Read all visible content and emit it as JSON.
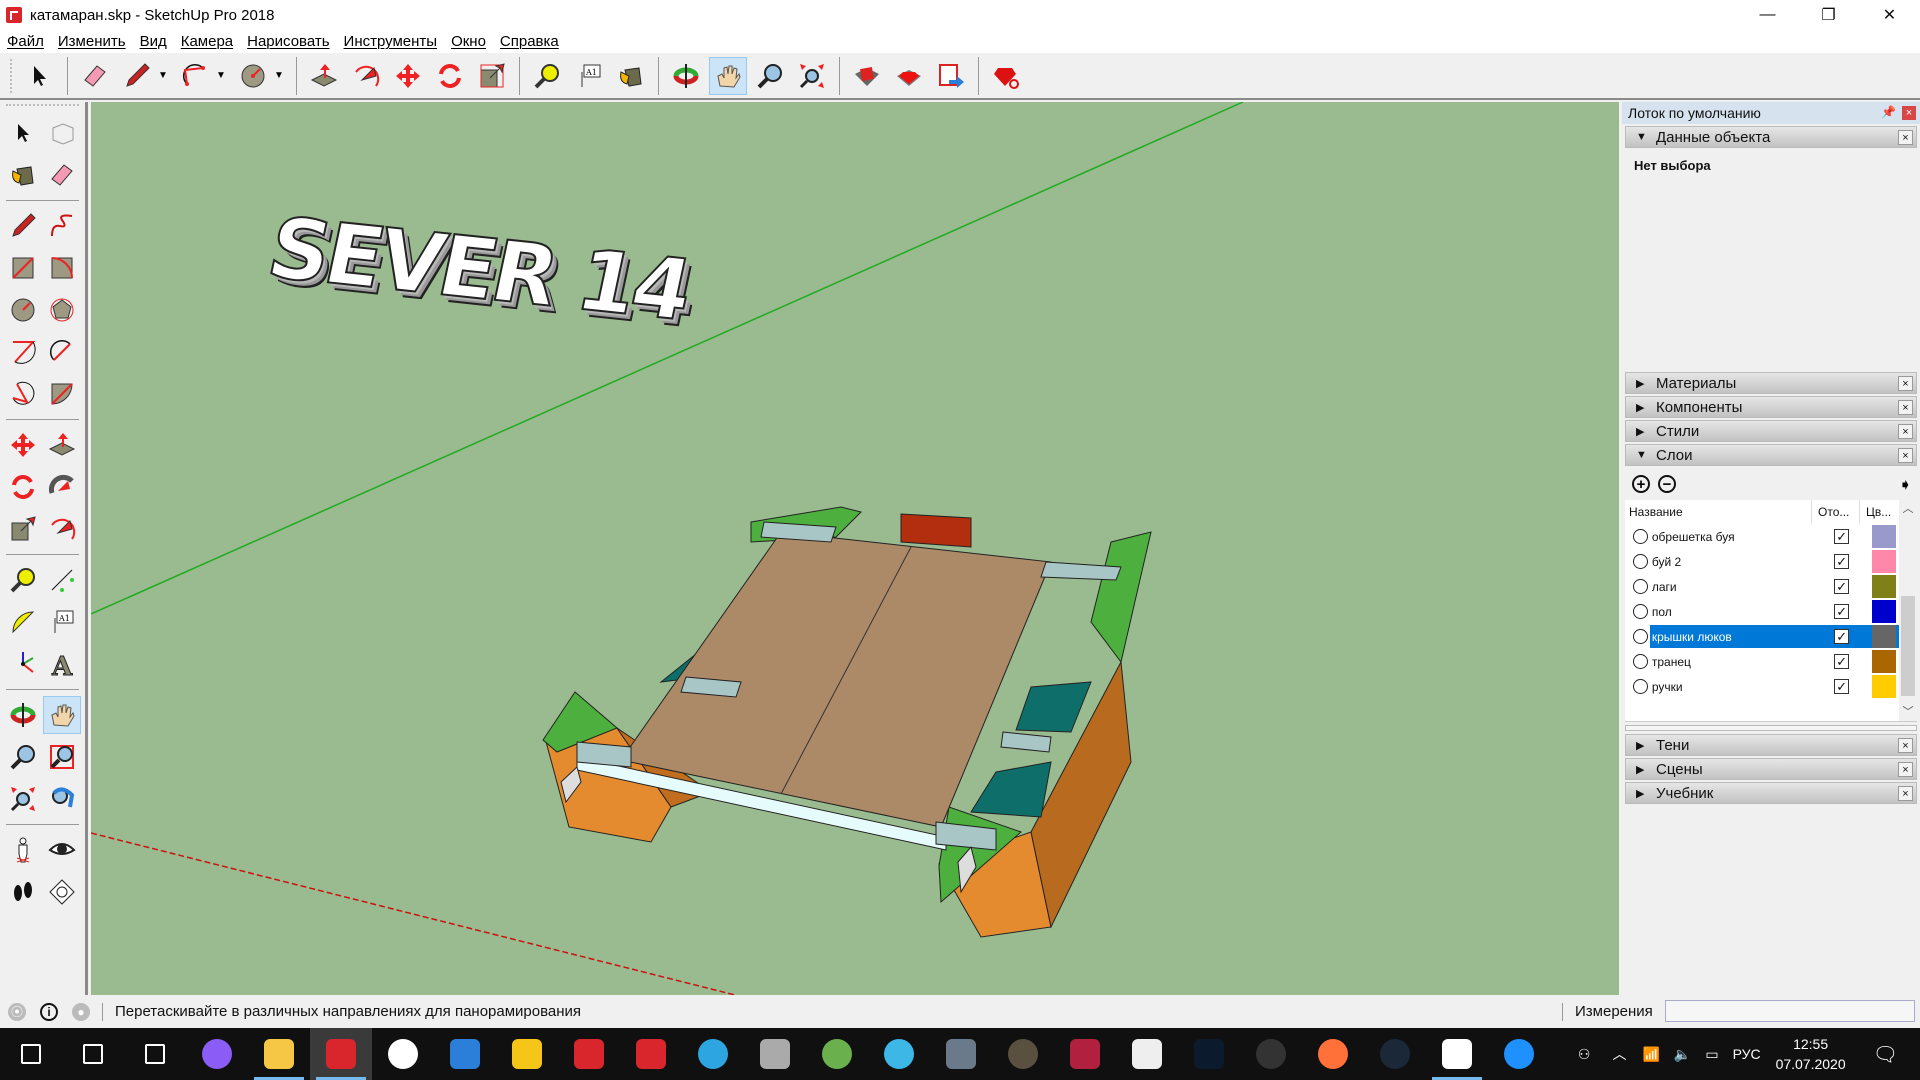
{
  "window": {
    "title": "катамаран.skp - SketchUp Pro 2018",
    "controls": {
      "minimize": "—",
      "restore": "❐",
      "close": "✕"
    }
  },
  "menu": [
    "Файл",
    "Изменить",
    "Вид",
    "Камера",
    "Нарисовать",
    "Инструменты",
    "Окно",
    "Справка"
  ],
  "toolbar": {
    "tools": [
      "select",
      "eraser",
      "pencil",
      "arc",
      "circle",
      "push-pull",
      "follow-me",
      "move",
      "rotate",
      "scale",
      "tape-measure",
      "text",
      "paint-bucket",
      "orbit",
      "pan",
      "zoom",
      "zoom-extents",
      "3d-warehouse",
      "extension-warehouse",
      "layout",
      "extension-manager"
    ],
    "active_tool": "pan"
  },
  "viewport": {
    "model_label_text": "SEVER 14",
    "background_color": "#99bb8f",
    "axis_colors": {
      "green": "#22aa22",
      "red": "#cc1111"
    }
  },
  "tray": {
    "title": "Лоток по умолчанию",
    "pin": "📌",
    "close": "×",
    "entity_info": {
      "title": "Данные объекта",
      "status": "Нет выбора"
    },
    "panels_collapsed_top": [
      "Материалы",
      "Компоненты",
      "Стили"
    ],
    "layers_panel": {
      "title": "Слои",
      "add": "+",
      "remove": "−",
      "columns": [
        "Название",
        "Ото...",
        "Цв..."
      ],
      "rows": [
        {
          "name": "обрешетка буя",
          "visible": true,
          "color": "#9999cc",
          "selected": false
        },
        {
          "name": "буй 2",
          "visible": true,
          "color": "#ff88aa",
          "selected": false
        },
        {
          "name": "лаги",
          "visible": true,
          "color": "#808019",
          "selected": false
        },
        {
          "name": "пол",
          "visible": true,
          "color": "#0000cc",
          "selected": false
        },
        {
          "name": "крышки люков",
          "visible": true,
          "color": "#666666",
          "selected": true
        },
        {
          "name": "транец",
          "visible": true,
          "color": "#aa6600",
          "selected": false
        },
        {
          "name": "ручки",
          "visible": true,
          "color": "#ffcc00",
          "selected": false
        }
      ],
      "check_mark": "✓"
    },
    "panels_collapsed_bottom": [
      "Тени",
      "Сцены",
      "Учебник"
    ],
    "expanded_arrow": "▼",
    "collapsed_arrow": "▶",
    "panel_close": "×"
  },
  "statusbar": {
    "hint": "Перетаскивайте в различных направлениях для панорамирования",
    "measurements_label": "Измерения",
    "measurements_value": ""
  },
  "taskbar": {
    "apps": [
      "start",
      "search",
      "task-view",
      "alice",
      "file-explorer",
      "sketchup",
      "yandex-browser",
      "app-blue",
      "notes",
      "layout",
      "style-builder",
      "telegram",
      "disk-tool",
      "utorrent",
      "app-cyan",
      "game-1",
      "game-2",
      "h2",
      "file",
      "photoshop",
      "davinci-resolve",
      "firefox",
      "steam",
      "video-editor",
      "help"
    ],
    "active_app": "sketchup",
    "language": "РУС",
    "time": "12:55",
    "date": "07.07.2020"
  }
}
